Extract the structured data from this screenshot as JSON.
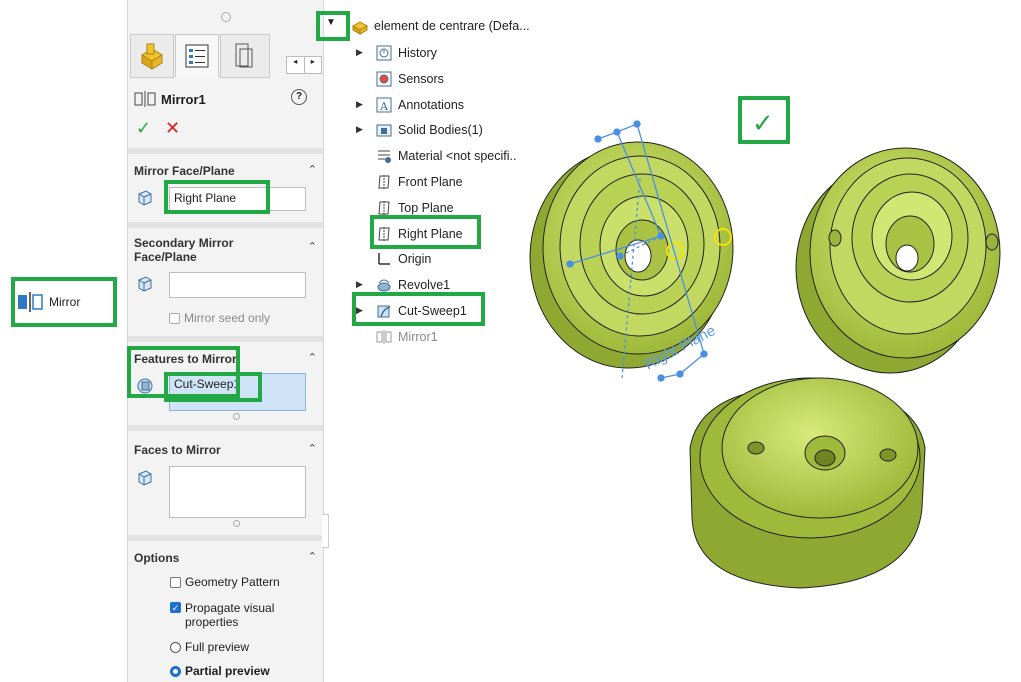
{
  "toolbar": {
    "mirror_label": "Mirror"
  },
  "property_manager": {
    "title": "Mirror1",
    "sections": {
      "mirror_face": {
        "title": "Mirror Face/Plane",
        "value": "Right Plane"
      },
      "secondary_mirror": {
        "title_line1": "Secondary Mirror",
        "title_line2": "Face/Plane",
        "value": "",
        "seed_only_label": "Mirror seed only",
        "seed_only_checked": false
      },
      "features": {
        "title": "Features to Mirror",
        "value": "Cut-Sweep1"
      },
      "faces": {
        "title": "Faces to Mirror",
        "value": ""
      },
      "options": {
        "title": "Options",
        "geometry_pattern": {
          "label": "Geometry Pattern",
          "checked": false
        },
        "propagate": {
          "label_line1": "Propagate visual",
          "label_line2": "properties",
          "checked": true
        },
        "full_preview": {
          "label": "Full preview",
          "selected": false
        },
        "partial_preview": {
          "label": "Partial preview",
          "selected": true
        }
      }
    },
    "help_glyph": "?"
  },
  "feature_tree": {
    "root": "element de centrare (Defa...",
    "items": [
      {
        "label": "History",
        "icon": "history-icon",
        "expandable": true
      },
      {
        "label": "Sensors",
        "icon": "sensors-icon",
        "expandable": false
      },
      {
        "label": "Annotations",
        "icon": "annotations-icon",
        "expandable": true
      },
      {
        "label": "Solid Bodies(1)",
        "icon": "solid-bodies-icon",
        "expandable": true
      },
      {
        "label": "Material <not specifi..",
        "icon": "material-icon",
        "expandable": false
      },
      {
        "label": "Front Plane",
        "icon": "plane-icon",
        "expandable": false
      },
      {
        "label": "Top Plane",
        "icon": "plane-icon",
        "expandable": false
      },
      {
        "label": "Right Plane",
        "icon": "plane-icon",
        "expandable": false
      },
      {
        "label": "Origin",
        "icon": "origin-icon",
        "expandable": false
      },
      {
        "label": "Revolve1",
        "icon": "revolve-icon",
        "expandable": true
      },
      {
        "label": "Cut-Sweep1",
        "icon": "cut-sweep-icon",
        "expandable": true
      },
      {
        "label": "Mirror1",
        "icon": "mirror-icon",
        "expandable": false
      }
    ]
  },
  "viewport": {
    "plane_label": "Right Plane"
  },
  "colors": {
    "highlight": "#22a845",
    "part": "#b5cf4a",
    "accept": "#2aa845",
    "cancel": "#e02020",
    "selection": "#4a90e2"
  }
}
